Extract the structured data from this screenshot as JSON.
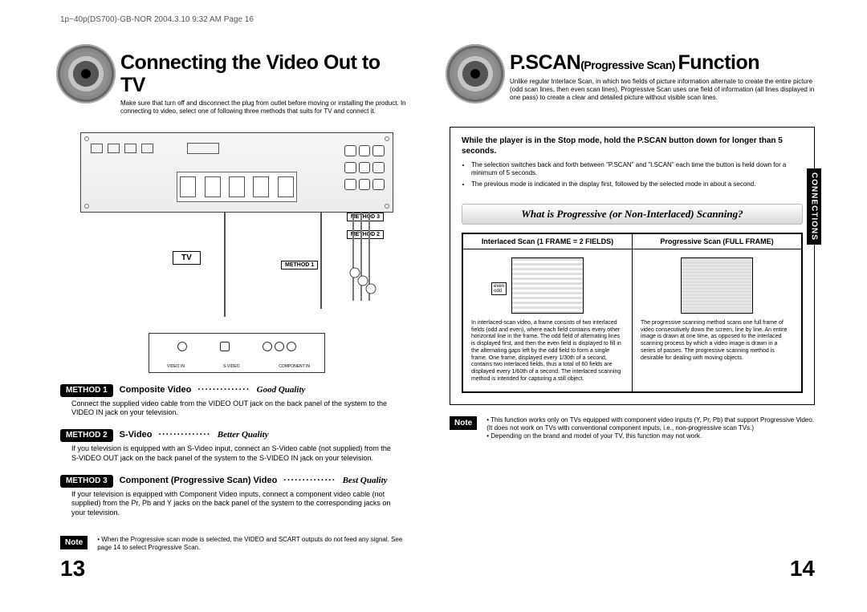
{
  "crop_mark": "1p~40p(DS700)-GB-NOR  2004.3.10  9:32 AM  Page 16",
  "side_tab": "CONNECTIONS",
  "left": {
    "title": "Connecting the Video Out to TV",
    "intro": "Make sure that turn off and disconnect the plug from outlet before moving or installing the product. In connecting to video, select one of following three methods that suits for TV and connect it.",
    "diagram": {
      "tv_label": "TV",
      "method_tags": [
        "METHOD 1",
        "METHOD 2",
        "METHOD 3"
      ],
      "tv_ports": [
        "VIDEO IN",
        "S-VIDEO",
        "COMPONENT IN"
      ]
    },
    "methods": [
      {
        "badge": "METHOD 1",
        "title": "Composite Video",
        "dots": "··············",
        "quality": "Good Quality",
        "body": "Connect the supplied video cable from the VIDEO OUT jack on the back panel of the system to the VIDEO IN jack on your television."
      },
      {
        "badge": "METHOD 2",
        "title": "S-Video",
        "dots": "··············",
        "quality": "Better Quality",
        "body": "If you television is equipped with an S-Video input, connect an S-Video cable (not supplied) from the S-VIDEO OUT jack on the back panel of the system to the S-VIDEO IN jack on your television."
      },
      {
        "badge": "METHOD 3",
        "title": "Component (Progressive Scan) Video",
        "dots": "··············",
        "quality": "Best Quality",
        "body": "If your television is equipped with Component Video inputs, connect a component video cable (not supplied) from the Pr, Pb and Y jacks on the back panel of the system to the corresponding jacks on your television."
      }
    ],
    "note_label": "Note",
    "note": "When the Progressive scan mode is selected, the VIDEO and SCART outputs do not feed any signal. See page 14 to select Progressive Scan.",
    "page_number": "13"
  },
  "right": {
    "title_main": "P.SCAN",
    "title_sub": "(Progressive Scan) ",
    "title_end": "Function",
    "intro": "Unlike regular Interlace Scan, in which two fields of picture information alternate to create the entire picture (odd scan lines, then even scan lines), Progressive Scan uses one field of information (all lines displayed in one pass) to create a clear and detailed picture without visible scan lines.",
    "box_hdr": "While the player is in the Stop mode, hold the P.SCAN button down for longer than 5 seconds.",
    "box_items": [
      "The selection switches back and forth between \"P.SCAN\" and \"I.SCAN\" each time the button is held down for a minimum of 5 seconds.",
      "The previous mode is indicated in the display first, followed by the selected mode in about a second."
    ],
    "q_title": "What is Progressive (or Non-Interlaced) Scanning?",
    "th_left": "Interlaced Scan (1 FRAME = 2 FIELDS)",
    "th_right": "Progressive Scan (FULL FRAME)",
    "even_odd": "even\nodd",
    "desc_left": "In interlaced-scan video, a frame consists of two interlaced fields (odd and even), where each field contains every other horizontal line in the frame. The odd field of alternating lines is displayed first, and then the even field is displayed to fill in the alternating gaps left by the odd field to form a single frame. One frame, displayed every 1/30th of a second, contains two interlaced fields, thus a total of 60 fields are displayed every 1/60th of a second. The interlaced scanning method is intended for capturing a still object.",
    "desc_right": "The progressive scanning method scans one full frame of video consecutively down the screen, line by line. An entire image is drawn at one time, as opposed to the interlaced scanning process by which a video image is drawn in a series of passes. The progressive scanning method is desirable for dealing with moving objects.",
    "note_label": "Note",
    "notes": [
      "This function works only on TVs equipped with component video inputs (Y, Pr, Pb) that support Progressive Video. (It does not work on TVs with conventional component inputs, i.e., non-progressive scan TVs.)",
      "Depending on the brand and model of your TV, this function may not work."
    ],
    "page_number": "14"
  }
}
